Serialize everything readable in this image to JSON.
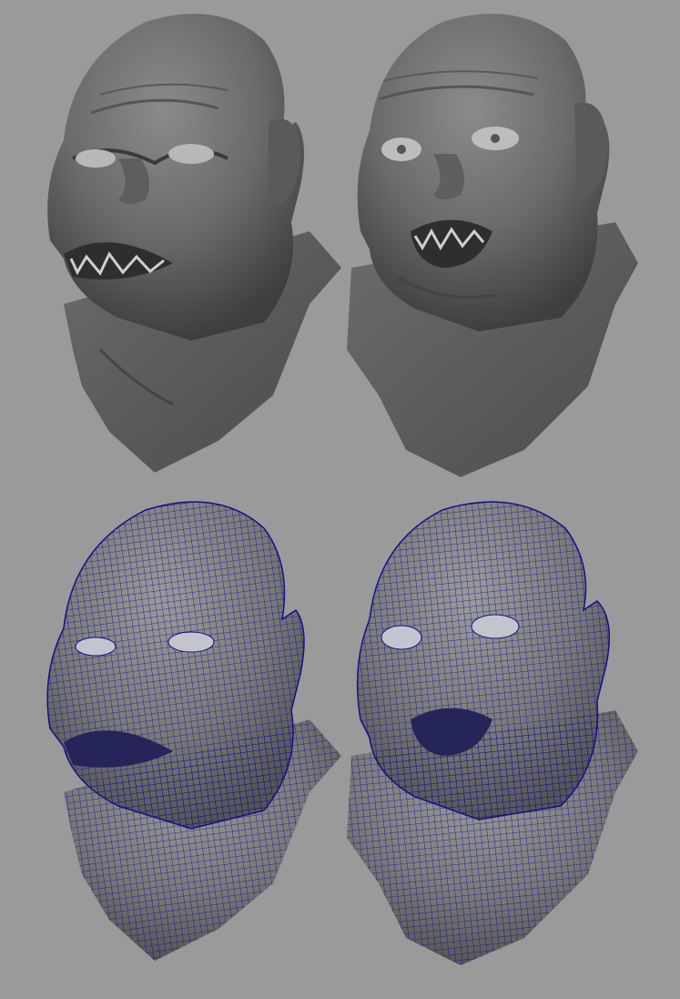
{
  "viewport": {
    "background": "#9a9a9a",
    "layout": "2x2 grid",
    "panels": [
      {
        "row": "top",
        "col": "left",
        "render_mode": "smooth-shaded",
        "expression": "snarl"
      },
      {
        "row": "top",
        "col": "right",
        "render_mode": "smooth-shaded",
        "expression": "fear"
      },
      {
        "row": "bottom",
        "col": "left",
        "render_mode": "wireframe-on-shaded",
        "expression": "snarl"
      },
      {
        "row": "bottom",
        "col": "right",
        "render_mode": "wireframe-on-shaded",
        "expression": "fear"
      }
    ]
  },
  "colors": {
    "shaded_mesh": "#6e6e6e",
    "wireframe": "#11118a"
  }
}
